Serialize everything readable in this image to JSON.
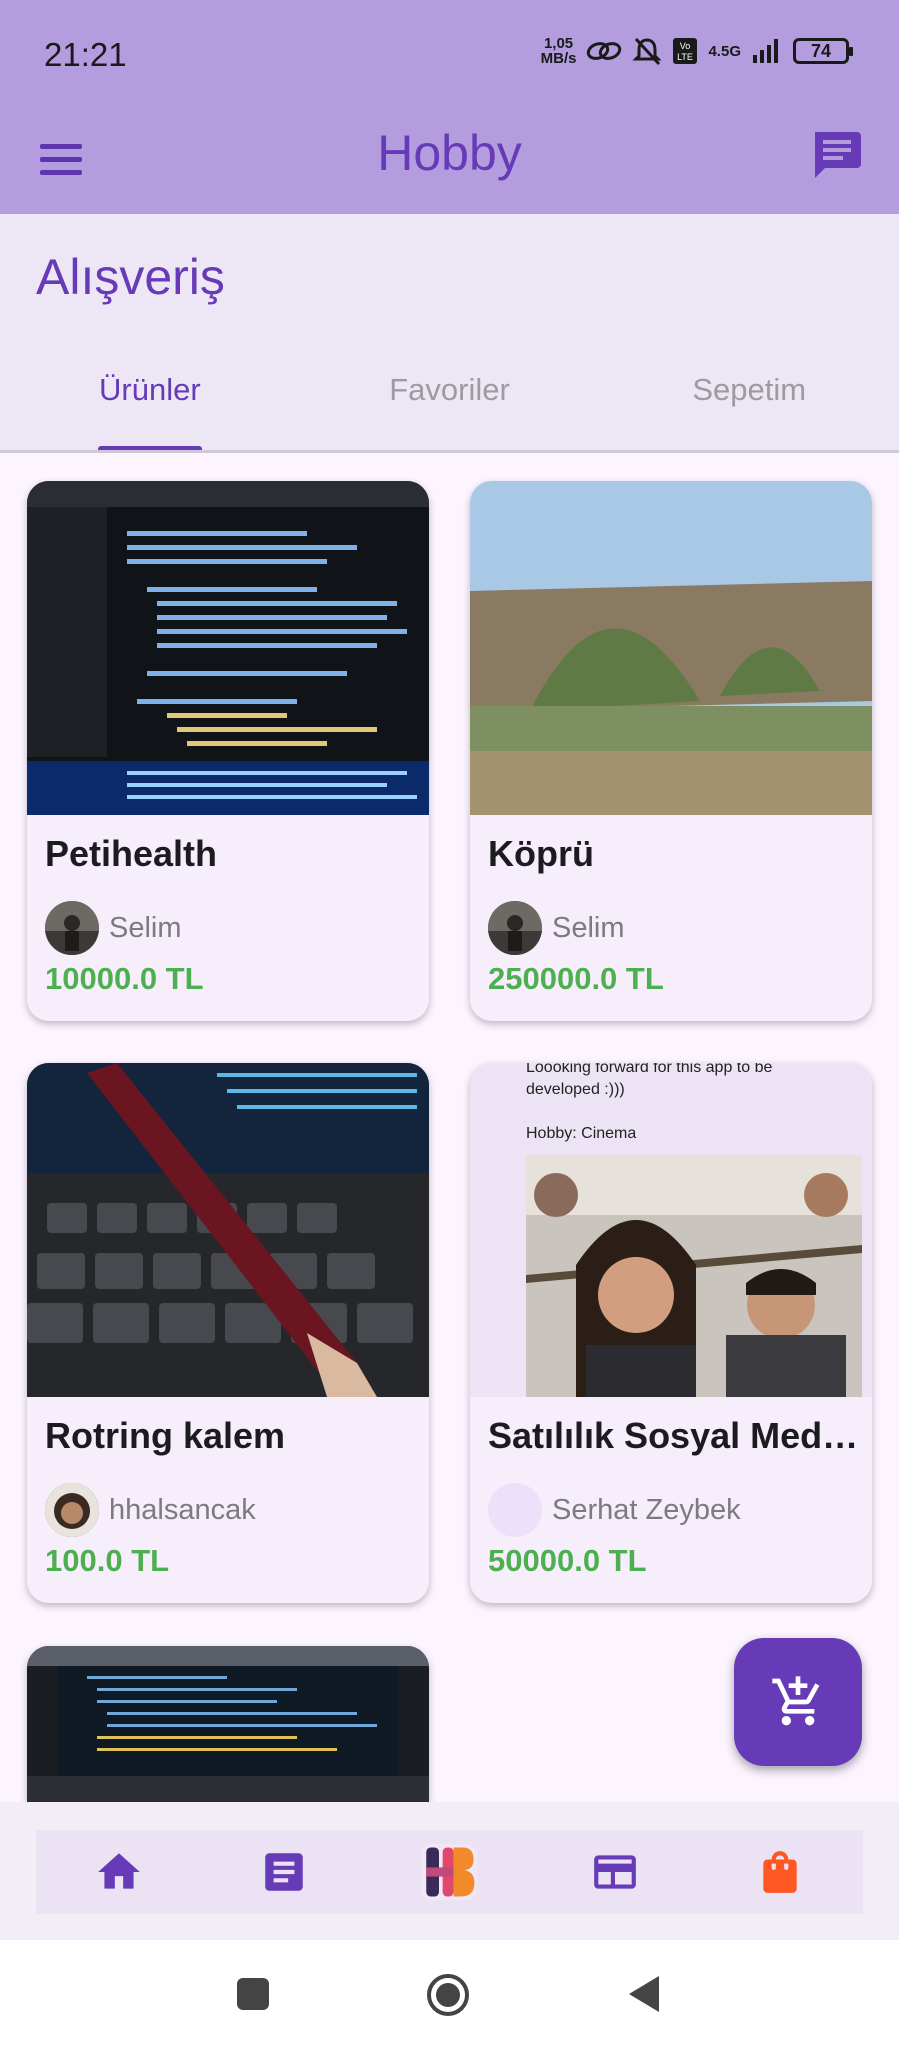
{
  "status": {
    "time": "21:21",
    "net_speed_value": "1,05",
    "net_speed_unit": "MB/s",
    "network": "4.5G",
    "battery": "74"
  },
  "appbar": {
    "title": "Hobby"
  },
  "page": {
    "title": "Alışveriş"
  },
  "tabs": [
    {
      "label": "Ürünler",
      "active": true
    },
    {
      "label": "Favoriler",
      "active": false
    },
    {
      "label": "Sepetim",
      "active": false
    }
  ],
  "products": [
    {
      "title": "Petihealth",
      "seller": "Selim",
      "price": "10000.0 TL"
    },
    {
      "title": "Köprü",
      "seller": "Selim",
      "price": "250000.0 TL"
    },
    {
      "title": "Rotring kalem",
      "seller": "hhalsancak",
      "price": "100.0 TL"
    },
    {
      "title": "Satılılık Sosyal Med…",
      "seller": "Serhat Zeybek",
      "price": "50000.0 TL",
      "image_text_1": "Loooking forward for this app to be developed :)))",
      "image_text_2": "Hobby: Cinema"
    }
  ],
  "icons": {
    "menu": "menu-icon",
    "chat": "chat-icon",
    "fab": "add-shopping-cart-icon",
    "nav": [
      "home-icon",
      "notes-icon",
      "hobby-logo",
      "calendar-icon",
      "shopping-bag-icon"
    ]
  },
  "colors": {
    "primary": "#673ab7",
    "appbar": "#b39ddf",
    "price": "#4caf50",
    "bag": "#ff5722"
  }
}
